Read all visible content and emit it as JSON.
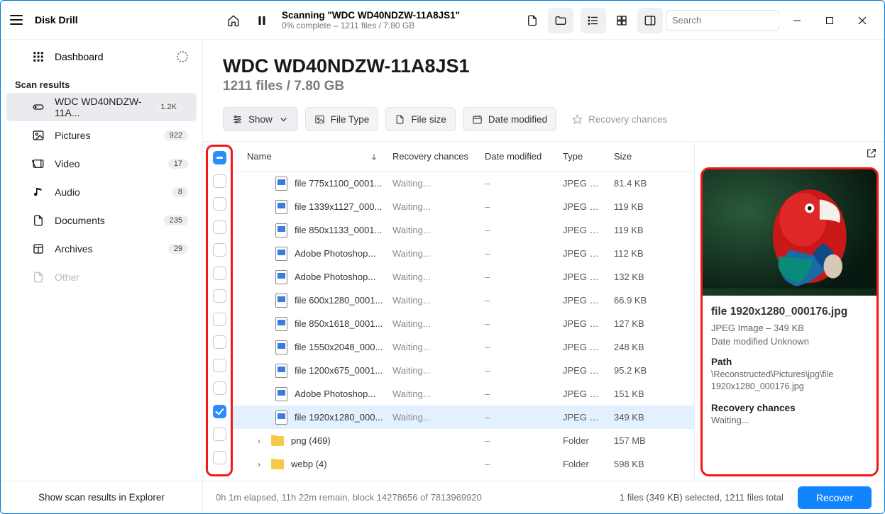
{
  "app": {
    "title": "Disk Drill"
  },
  "topbar": {
    "scan_title": "Scanning \"WDC WD40NDZW-11A8JS1\"",
    "scan_sub": "0% complete – 1211 files / 7.80 GB",
    "search_placeholder": "Search"
  },
  "sidebar": {
    "dashboard_label": "Dashboard",
    "section_label": "Scan results",
    "items": [
      {
        "label": "WDC WD40NDZW-11A...",
        "badge": "1.2K",
        "selected": true,
        "icon": "drive"
      },
      {
        "label": "Pictures",
        "badge": "922",
        "icon": "picture"
      },
      {
        "label": "Video",
        "badge": "17",
        "icon": "video"
      },
      {
        "label": "Audio",
        "badge": "8",
        "icon": "audio"
      },
      {
        "label": "Documents",
        "badge": "235",
        "icon": "document"
      },
      {
        "label": "Archives",
        "badge": "29",
        "icon": "archive"
      },
      {
        "label": "Other",
        "badge": "",
        "icon": "other",
        "muted": true
      }
    ],
    "footer": "Show scan results in Explorer"
  },
  "main": {
    "title": "WDC WD40NDZW-11A8JS1",
    "subtitle": "1211 files / 7.80 GB",
    "filters": {
      "show": "Show",
      "file_type": "File Type",
      "file_size": "File size",
      "date_modified": "Date modified",
      "recovery_chances": "Recovery chances"
    },
    "columns": {
      "name": "Name",
      "recovery": "Recovery chances",
      "date": "Date modified",
      "type": "Type",
      "size": "Size"
    },
    "rows": [
      {
        "name": "file 775x1100_0001...",
        "rec": "Waiting...",
        "date": "–",
        "type": "JPEG Im...",
        "size": "81.4 KB",
        "kind": "file"
      },
      {
        "name": "file 1339x1127_000...",
        "rec": "Waiting...",
        "date": "–",
        "type": "JPEG Im...",
        "size": "119 KB",
        "kind": "file"
      },
      {
        "name": "file 850x1133_0001...",
        "rec": "Waiting...",
        "date": "–",
        "type": "JPEG Im...",
        "size": "119 KB",
        "kind": "file"
      },
      {
        "name": "Adobe Photoshop...",
        "rec": "Waiting...",
        "date": "–",
        "type": "JPEG Im...",
        "size": "112 KB",
        "kind": "file"
      },
      {
        "name": "Adobe Photoshop...",
        "rec": "Waiting...",
        "date": "–",
        "type": "JPEG Im...",
        "size": "132 KB",
        "kind": "file"
      },
      {
        "name": "file 600x1280_0001...",
        "rec": "Waiting...",
        "date": "–",
        "type": "JPEG Im...",
        "size": "66.9 KB",
        "kind": "file"
      },
      {
        "name": "file 850x1618_0001...",
        "rec": "Waiting...",
        "date": "–",
        "type": "JPEG Im...",
        "size": "127 KB",
        "kind": "file"
      },
      {
        "name": "file 1550x2048_000...",
        "rec": "Waiting...",
        "date": "–",
        "type": "JPEG Im...",
        "size": "248 KB",
        "kind": "file"
      },
      {
        "name": "file 1200x675_0001...",
        "rec": "Waiting...",
        "date": "–",
        "type": "JPEG Im...",
        "size": "95.2 KB",
        "kind": "file"
      },
      {
        "name": "Adobe Photoshop...",
        "rec": "Waiting...",
        "date": "–",
        "type": "JPEG Im...",
        "size": "151 KB",
        "kind": "file"
      },
      {
        "name": "file 1920x1280_000...",
        "rec": "Waiting...",
        "date": "–",
        "type": "JPEG Im...",
        "size": "349 KB",
        "kind": "file",
        "selected": true
      },
      {
        "name": "png (469)",
        "rec": "",
        "date": "–",
        "type": "Folder",
        "size": "157 MB",
        "kind": "folder"
      },
      {
        "name": "webp (4)",
        "rec": "",
        "date": "–",
        "type": "Folder",
        "size": "598 KB",
        "kind": "folder"
      }
    ]
  },
  "preview": {
    "filename": "file 1920x1280_000176.jpg",
    "type_line": "JPEG Image – 349 KB",
    "date_line": "Date modified Unknown",
    "path_hdr": "Path",
    "path": "\\Reconstructed\\Pictures\\jpg\\file 1920x1280_000176.jpg",
    "rec_hdr": "Recovery chances",
    "rec_val": "Waiting..."
  },
  "footer": {
    "left": "0h 1m elapsed, 11h 22m remain, block 14278656 of 7813969920",
    "right": "1 files (349 KB) selected, 1211 files total",
    "button": "Recover"
  }
}
